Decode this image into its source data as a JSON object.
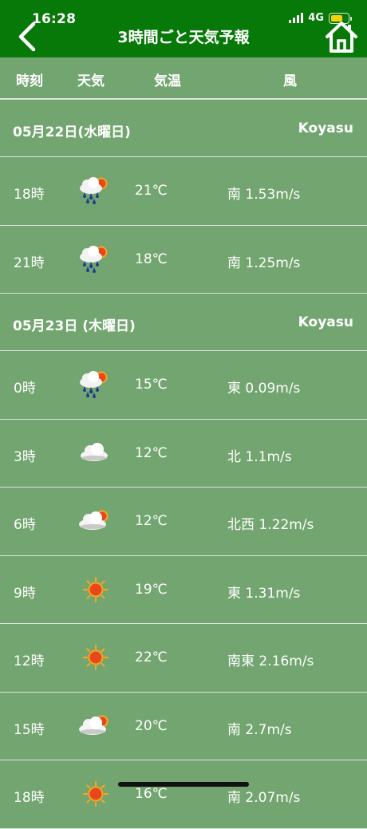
{
  "status_bar": {
    "time": "16:28",
    "network": "4G",
    "battery_level": 0.7
  },
  "header": {
    "title": "3時間ごと天気予報",
    "back_icon": "chevron-left-icon",
    "home_icon": "home-icon"
  },
  "columns": {
    "time": "時刻",
    "weather": "天気",
    "temp": "気温",
    "wind": "風"
  },
  "colors": {
    "header_bg": "#077909",
    "page_bg": "#72a56f",
    "text": "#ffffff"
  },
  "days": [
    {
      "date": "05月22日(水曜日)",
      "place": "Koyasu",
      "rows": [
        {
          "time": "18時",
          "icon": "rain-cloud-sun-icon",
          "temp": "21℃",
          "wind": "南 1.53m/s"
        },
        {
          "time": "21時",
          "icon": "rain-cloud-sun-icon",
          "temp": "18℃",
          "wind": "南 1.25m/s"
        }
      ]
    },
    {
      "date": "05月23日 (木曜日)",
      "place": "Koyasu",
      "rows": [
        {
          "time": "0時",
          "icon": "rain-cloud-sun-icon",
          "temp": "15℃",
          "wind": "東 0.09m/s"
        },
        {
          "time": "3時",
          "icon": "cloud-icon",
          "temp": "12℃",
          "wind": "北 1.1m/s"
        },
        {
          "time": "6時",
          "icon": "cloud-sun-icon",
          "temp": "12℃",
          "wind": "北西 1.22m/s"
        },
        {
          "time": "9時",
          "icon": "sun-icon",
          "temp": "19℃",
          "wind": "東 1.31m/s"
        },
        {
          "time": "12時",
          "icon": "sun-icon",
          "temp": "22℃",
          "wind": "南東 2.16m/s"
        },
        {
          "time": "15時",
          "icon": "cloud-sun-icon",
          "temp": "20℃",
          "wind": "南 2.7m/s"
        },
        {
          "time": "18時",
          "icon": "sun-icon",
          "temp": "16℃",
          "wind": "南 2.07m/s"
        }
      ]
    }
  ]
}
